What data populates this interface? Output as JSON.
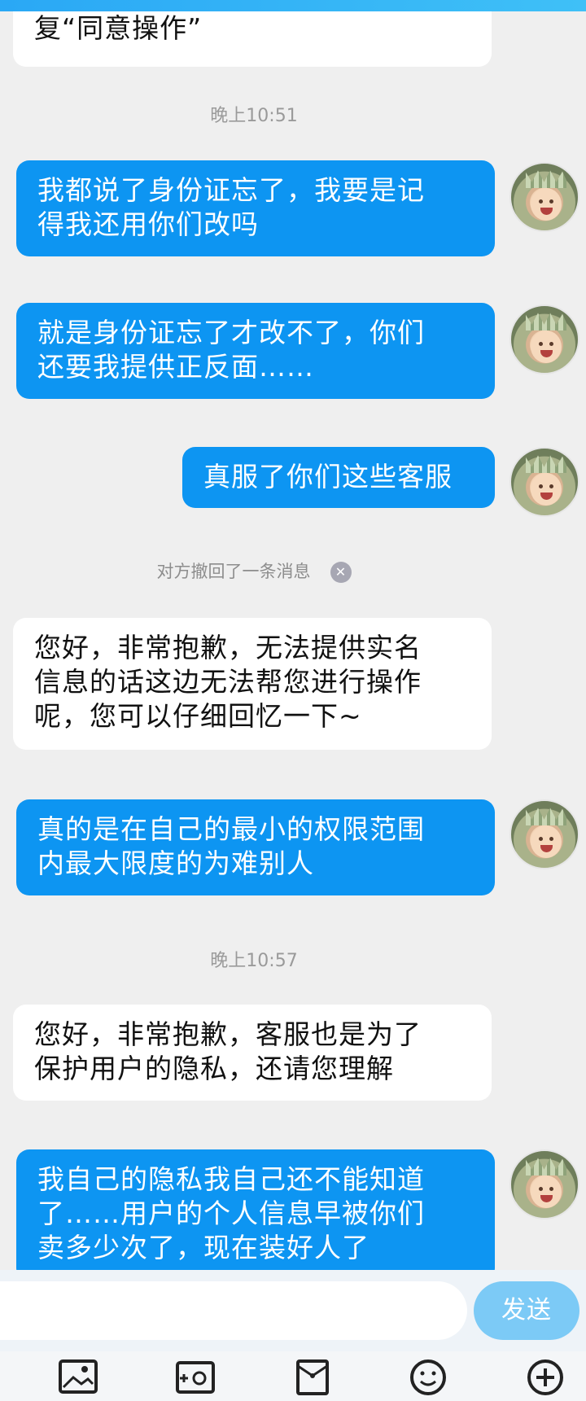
{
  "messages": [
    {
      "side": "left",
      "text": "复“同意操作”"
    },
    {
      "type": "timestamp",
      "text": "晚上10:51"
    },
    {
      "side": "right",
      "text": "我都说了身份证忘了，我要是记\n得我还用你们改吗"
    },
    {
      "side": "right",
      "text": "就是身份证忘了才改不了，你们\n还要我提供正反面……"
    },
    {
      "side": "right",
      "text": "真服了你们这些客服"
    },
    {
      "type": "recall",
      "text": "对方撤回了一条消息"
    },
    {
      "side": "left",
      "text": "您好，非常抱歉，无法提供实名\n信息的话这边无法帮您进行操作\n呢，您可以仔细回忆一下~"
    },
    {
      "side": "right",
      "text": "真的是在自己的最小的权限范围\n内最大限度的为难别人"
    },
    {
      "type": "timestamp",
      "text": "晚上10:57"
    },
    {
      "side": "left",
      "text": "您好，非常抱歉，客服也是为了\n保护用户的隐私，还请您理解"
    },
    {
      "side": "right",
      "text": "我自己的隐私我自己还不能知道\n了……用户的个人信息早被你们\n卖多少次了，现在装好人了"
    }
  ],
  "recall_close_glyph": "✕",
  "composer": {
    "placeholder": "",
    "send_label": "发送"
  },
  "colors": {
    "accent": "#0d95f2",
    "send": "#7ccaf6",
    "background": "#efefef"
  },
  "toolbar_icons": [
    "image-icon",
    "camera-icon",
    "red-packet-icon",
    "emoji-icon",
    "plus-icon"
  ]
}
